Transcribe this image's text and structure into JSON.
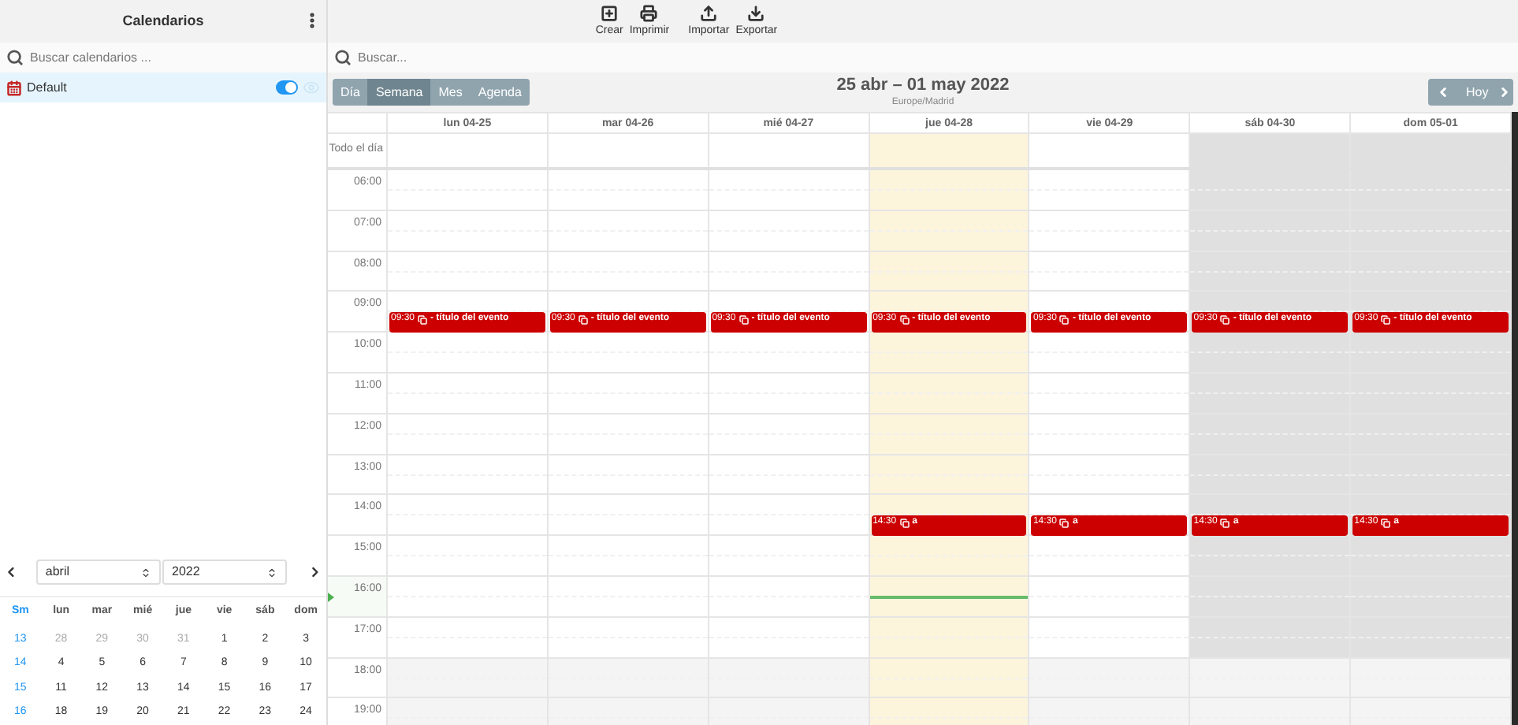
{
  "sidebar": {
    "title": "Calendarios",
    "search": {
      "placeholder": "Buscar calendarios ..."
    },
    "calendars": [
      {
        "name": "Default",
        "selected": true,
        "on": true
      }
    ],
    "mini_calendar": {
      "month": "abril",
      "year": "2022",
      "week_header": "Sm",
      "weekdays": [
        "lun",
        "mar",
        "mié",
        "jue",
        "vie",
        "sáb",
        "dom"
      ],
      "weeks": [
        {
          "week": "13",
          "days": [
            {
              "label": "28",
              "outside": true
            },
            {
              "label": "29",
              "outside": true
            },
            {
              "label": "30",
              "outside": true
            },
            {
              "label": "31",
              "outside": true
            },
            {
              "label": "1",
              "outside": false
            },
            {
              "label": "2",
              "outside": false
            },
            {
              "label": "3",
              "outside": false
            }
          ]
        },
        {
          "week": "14",
          "days": [
            {
              "label": "4",
              "outside": false
            },
            {
              "label": "5",
              "outside": false
            },
            {
              "label": "6",
              "outside": false
            },
            {
              "label": "7",
              "outside": false
            },
            {
              "label": "8",
              "outside": false
            },
            {
              "label": "9",
              "outside": false
            },
            {
              "label": "10",
              "outside": false
            }
          ]
        },
        {
          "week": "15",
          "days": [
            {
              "label": "11",
              "outside": false
            },
            {
              "label": "12",
              "outside": false
            },
            {
              "label": "13",
              "outside": false
            },
            {
              "label": "14",
              "outside": false
            },
            {
              "label": "15",
              "outside": false
            },
            {
              "label": "16",
              "outside": false
            },
            {
              "label": "17",
              "outside": false
            }
          ]
        },
        {
          "week": "16",
          "days": [
            {
              "label": "18",
              "outside": false
            },
            {
              "label": "19",
              "outside": false
            },
            {
              "label": "20",
              "outside": false
            },
            {
              "label": "21",
              "outside": false
            },
            {
              "label": "22",
              "outside": false
            },
            {
              "label": "23",
              "outside": false
            },
            {
              "label": "24",
              "outside": false
            }
          ]
        }
      ]
    }
  },
  "toolbar": [
    {
      "label": "Crear",
      "kind": "create"
    },
    {
      "label": "Imprimir",
      "kind": "print"
    },
    {
      "label": "Importar",
      "kind": "import"
    },
    {
      "label": "Exportar",
      "kind": "export"
    }
  ],
  "search": {
    "placeholder": "Buscar..."
  },
  "views": [
    {
      "label": "Día",
      "selected": false
    },
    {
      "label": "Semana",
      "selected": true
    },
    {
      "label": "Mes",
      "selected": false
    },
    {
      "label": "Agenda",
      "selected": false
    }
  ],
  "range_title": "25 abr – 01 may 2022",
  "timezone": "Europe/Madrid",
  "today_button": "Hoy",
  "all_day_label": "Todo el día",
  "hours": [
    {
      "label": "06:00",
      "current": false
    },
    {
      "label": "07:00",
      "current": false
    },
    {
      "label": "08:00",
      "current": false
    },
    {
      "label": "09:00",
      "current": false
    },
    {
      "label": "10:00",
      "current": false
    },
    {
      "label": "11:00",
      "current": false
    },
    {
      "label": "12:00",
      "current": false
    },
    {
      "label": "13:00",
      "current": false
    },
    {
      "label": "14:00",
      "current": false
    },
    {
      "label": "15:00",
      "current": false
    },
    {
      "label": "16:00",
      "current": true
    },
    {
      "label": "17:00",
      "current": false
    },
    {
      "label": "18:00",
      "current": false
    },
    {
      "label": "19:00",
      "current": false
    }
  ],
  "days": [
    {
      "label": "lun 04-25",
      "today": false,
      "weekend": false,
      "events": [
        {
          "time": "09:30",
          "title": "- título del evento"
        }
      ]
    },
    {
      "label": "mar 04-26",
      "today": false,
      "weekend": false,
      "events": [
        {
          "time": "09:30",
          "title": "- título del evento"
        }
      ]
    },
    {
      "label": "mié 04-27",
      "today": false,
      "weekend": false,
      "events": [
        {
          "time": "09:30",
          "title": "- título del evento"
        }
      ]
    },
    {
      "label": "jue 04-28",
      "today": true,
      "weekend": false,
      "events": [
        {
          "time": "09:30",
          "title": "- título del evento"
        },
        {
          "time": "14:30",
          "title": "a"
        }
      ]
    },
    {
      "label": "vie 04-29",
      "today": false,
      "weekend": false,
      "events": [
        {
          "time": "09:30",
          "title": "- título del evento"
        },
        {
          "time": "14:30",
          "title": "a"
        }
      ]
    },
    {
      "label": "sáb 04-30",
      "today": false,
      "weekend": true,
      "events": [
        {
          "time": "09:30",
          "title": "- título del evento"
        },
        {
          "time": "14:30",
          "title": "a"
        }
      ]
    },
    {
      "label": "dom 05-01",
      "today": false,
      "weekend": true,
      "events": [
        {
          "time": "09:30",
          "title": "- título del evento"
        },
        {
          "time": "14:30",
          "title": "a"
        }
      ]
    }
  ]
}
